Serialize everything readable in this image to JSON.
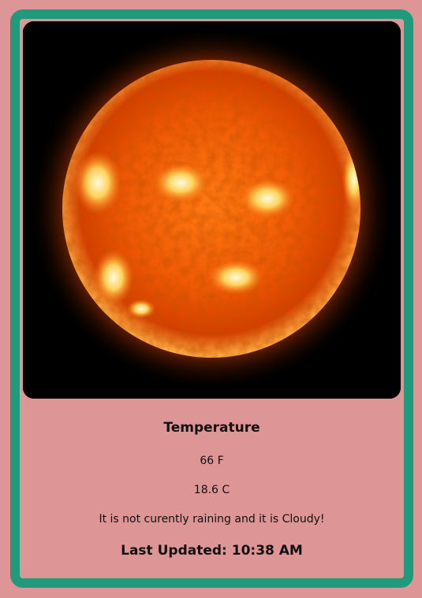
{
  "weather": {
    "image_subject": "sun",
    "heading": "Temperature",
    "fahrenheit": "66 F",
    "celsius": "18.6 C",
    "description": "It is not curently raining and it is Cloudy!",
    "last_updated": "Last Updated: 10:38 AM"
  },
  "colors": {
    "background": "#dd9596",
    "card_border": "#1f9a7c"
  }
}
